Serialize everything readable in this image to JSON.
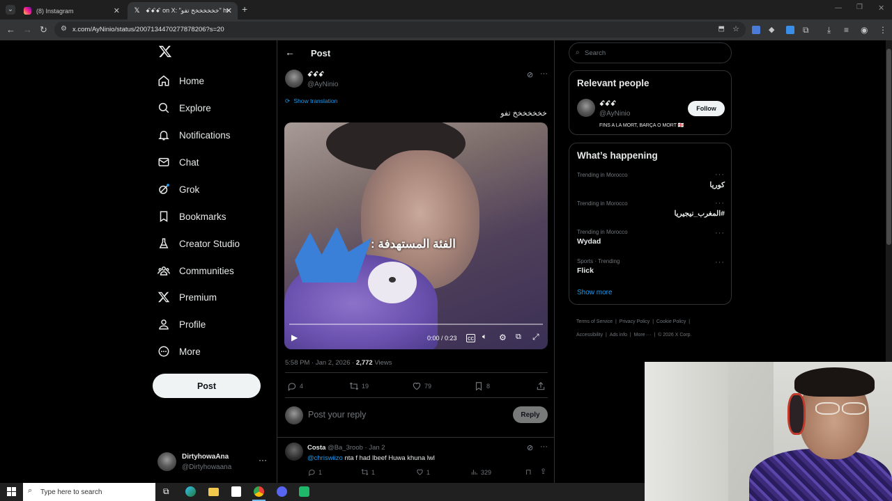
{
  "browser": {
    "tabs": [
      {
        "title": "(8) Instagram",
        "active": false
      },
      {
        "title": "ꗃꗃꗃ on X: \"خخخخخخخ تفو\" https:",
        "active": true
      }
    ],
    "url": "x.com/AyNinio/status/2007134470277878206?s=20"
  },
  "nav": {
    "items": [
      {
        "label": "Home",
        "icon": "home-icon"
      },
      {
        "label": "Explore",
        "icon": "search-icon"
      },
      {
        "label": "Notifications",
        "icon": "bell-icon"
      },
      {
        "label": "Chat",
        "icon": "mail-icon"
      },
      {
        "label": "Grok",
        "icon": "grok-icon"
      },
      {
        "label": "Bookmarks",
        "icon": "bookmark-icon"
      },
      {
        "label": "Creator Studio",
        "icon": "creator-studio-icon"
      },
      {
        "label": "Communities",
        "icon": "communities-icon"
      },
      {
        "label": "Premium",
        "icon": "x-logo-icon"
      },
      {
        "label": "Profile",
        "icon": "profile-icon"
      },
      {
        "label": "More",
        "icon": "more-circle-icon"
      }
    ],
    "post_label": "Post",
    "account": {
      "name": "DirtyhowaAna",
      "handle": "@Dirtyhowaana"
    }
  },
  "header": {
    "title": "Post"
  },
  "tweet": {
    "author_name": "ꗃꗃꗃ",
    "author_handle": "@AyNinio",
    "show_translation": "Show translation",
    "text": "خخخخخخخ تفو",
    "video_caption": "الفئة المستهدفة :",
    "video_time": "0:00 / 0:23",
    "video_progress": 0,
    "time": "5:58 PM · Jan 2, 2026 · ",
    "views_count": "2,772",
    "views_label": " Views",
    "stats": {
      "replies": "4",
      "reposts": "19",
      "likes": "79",
      "bookmarks": "8"
    }
  },
  "reply_box": {
    "placeholder": "Post your reply",
    "button": "Reply"
  },
  "reply": {
    "name": "Costa",
    "meta": "@Ba_3roob · Jan 2",
    "mention": "@chriswiizo",
    "text": " nta f had lbeef Huwa khuna lwl",
    "stats": {
      "replies": "1",
      "reposts": "1",
      "likes": "1",
      "views": "329"
    }
  },
  "search": {
    "placeholder": "Search"
  },
  "relevant_people": {
    "title": "Relevant people",
    "name": "ꗃꗃꗃ",
    "handle": "@AyNinio",
    "follow_label": "Follow",
    "bio": "FINS A LA MORT, BARÇA O MORT 🏴󠁧󠁢󠁥󠁮󠁧󠁿"
  },
  "whats_happening": {
    "title": "What’s happening",
    "trends": [
      {
        "category": "Trending in Morocco",
        "name": "كوريا"
      },
      {
        "category": "Trending in Morocco",
        "name": "#المغرب_نيجيريا"
      },
      {
        "category": "Trending in Morocco",
        "name": "Wydad"
      },
      {
        "category": "Sports · Trending",
        "name": "Flick"
      }
    ],
    "show_more": "Show more"
  },
  "footer": {
    "links": [
      "Terms of Service",
      "Privacy Policy",
      "Cookie Policy",
      "Accessibility",
      "Ads info",
      "More ···"
    ],
    "copyright": "© 2026 X Corp."
  },
  "taskbar": {
    "search_placeholder": "Type here to search"
  },
  "colors": {
    "accent": "#1d9bf0",
    "background": "#000000",
    "border": "#2f3336",
    "muted": "#71767b"
  }
}
